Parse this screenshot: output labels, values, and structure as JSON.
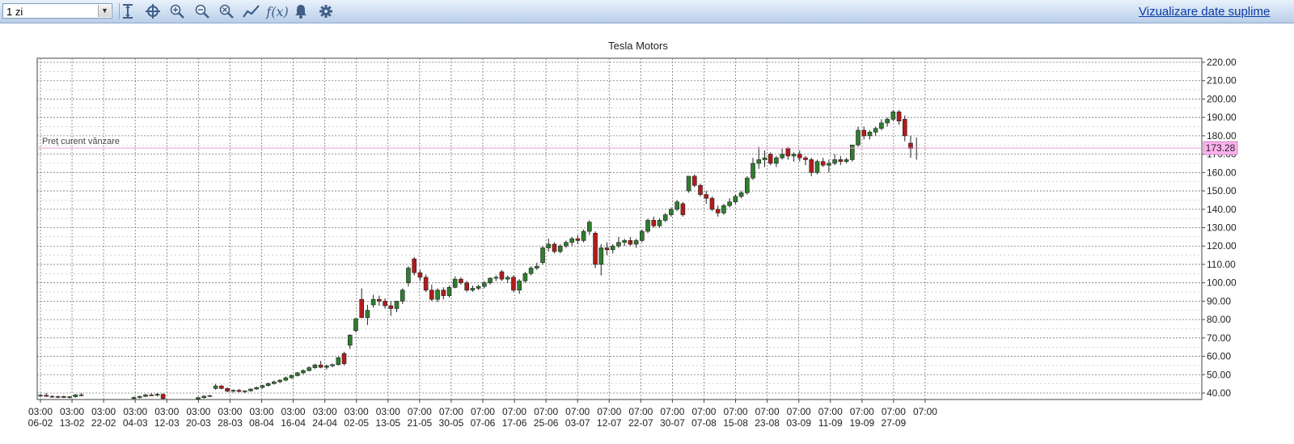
{
  "toolbar": {
    "period_value": "1 zi",
    "tools": [
      "cursor-icon",
      "crosshair-icon",
      "zoom-in-icon",
      "zoom-out-icon",
      "zoom-reset-icon",
      "line-chart-icon",
      "function-icon",
      "bell-icon",
      "gear-icon"
    ],
    "function_label": "f(x)",
    "link_text": "Vizualizare date suplime",
    "accent_color": "#4a6b94"
  },
  "chart_data": {
    "type": "candlestick",
    "title": "Tesla Motors",
    "ylim": [
      36,
      222
    ],
    "yticks": [
      "220.00",
      "210.00",
      "200.00",
      "190.00",
      "180.00",
      "170.00",
      "160.00",
      "150.00",
      "140.00",
      "130.00",
      "120.00",
      "110.00",
      "100.00",
      "90.00",
      "80.00",
      "70.00",
      "60.00",
      "50.00",
      "40.00"
    ],
    "current_price_label": "Preț curent vânzare",
    "current_price": 173.28,
    "current_price_text": "173.28",
    "xtick_times": [
      "03:00",
      "03:00",
      "03:00",
      "03:00",
      "03:00",
      "03:00",
      "03:00",
      "03:00",
      "03:00",
      "03:00",
      "03:00",
      "03:00",
      "07:00",
      "07:00",
      "07:00",
      "07:00",
      "07:00",
      "07:00",
      "07:00",
      "07:00",
      "07:00",
      "07:00",
      "07:00",
      "07:00",
      "07:00",
      "07:00",
      "07:00",
      "07:00",
      "07:00"
    ],
    "xtick_dates": [
      "06-02",
      "13-02",
      "22-02",
      "04-03",
      "12-03",
      "20-03",
      "28-03",
      "08-04",
      "16-04",
      "24-04",
      "02-05",
      "13-05",
      "21-05",
      "30-05",
      "07-06",
      "17-06",
      "25-06",
      "03-07",
      "12-07",
      "22-07",
      "30-07",
      "07-08",
      "15-08",
      "23-08",
      "03-09",
      "11-09",
      "19-09",
      "27-09",
      ""
    ],
    "grid": true,
    "colors": {
      "up": "#2f7d2f",
      "down": "#b31b1b",
      "price_line": "#e8a0d0",
      "price_label_bg": "#ffb3ef"
    },
    "candles": [
      [
        38.5,
        39.5,
        37.8,
        38.8
      ],
      [
        38.8,
        40.0,
        38.0,
        38.2
      ],
      [
        38.2,
        38.8,
        37.5,
        37.9
      ],
      [
        37.9,
        38.5,
        37.2,
        38.1
      ],
      [
        38.1,
        38.6,
        37.4,
        37.6
      ],
      [
        37.6,
        38.3,
        37.0,
        38.0
      ],
      [
        38.0,
        39.5,
        37.5,
        39.0
      ],
      [
        39.0,
        40.0,
        38.3,
        38.7
      ],
      null,
      null,
      null,
      null,
      null,
      null,
      null,
      null,
      [
        37.0,
        38.0,
        36.5,
        37.6
      ],
      [
        37.6,
        38.5,
        37.0,
        38.2
      ],
      [
        38.2,
        39.5,
        37.8,
        39.0
      ],
      [
        39.0,
        39.8,
        38.4,
        38.8
      ],
      [
        38.8,
        40.0,
        38.2,
        39.3
      ],
      [
        39.3,
        39.8,
        36.5,
        37.0
      ],
      null,
      null,
      null,
      null,
      null,
      [
        36.8,
        38.0,
        36.2,
        37.5
      ],
      [
        37.5,
        38.8,
        37.0,
        38.3
      ],
      [
        38.3,
        39.0,
        37.8,
        38.6
      ],
      [
        42.5,
        45.0,
        41.8,
        43.8
      ],
      [
        43.8,
        44.5,
        42.0,
        42.5
      ],
      [
        42.5,
        43.0,
        40.5,
        41.0
      ],
      [
        41.0,
        42.0,
        40.2,
        41.5
      ],
      [
        41.5,
        42.2,
        40.5,
        40.8
      ],
      [
        40.8,
        41.5,
        40.0,
        41.2
      ],
      [
        41.2,
        42.5,
        40.8,
        42.2
      ],
      [
        42.2,
        43.5,
        41.8,
        43.0
      ],
      [
        43.0,
        44.5,
        42.5,
        44.1
      ],
      [
        44.1,
        45.8,
        43.6,
        45.2
      ],
      [
        45.2,
        46.8,
        44.6,
        46.1
      ],
      [
        46.1,
        47.5,
        45.5,
        47.0
      ],
      [
        47.0,
        49.0,
        46.5,
        48.3
      ],
      [
        48.3,
        50.0,
        47.8,
        49.5
      ],
      [
        49.5,
        51.5,
        49.0,
        51.0
      ],
      [
        51.0,
        53.0,
        50.3,
        52.2
      ],
      [
        52.2,
        54.5,
        51.8,
        53.8
      ],
      [
        53.8,
        56.0,
        53.2,
        55.3
      ],
      [
        55.3,
        57.5,
        53.5,
        54.0
      ],
      [
        54.0,
        55.5,
        52.8,
        54.8
      ],
      [
        54.8,
        56.0,
        54.0,
        55.5
      ],
      [
        55.5,
        60.0,
        55.0,
        59.2
      ],
      [
        61.5,
        62.5,
        55.0,
        56.0
      ],
      [
        66.0,
        72.0,
        64.0,
        71.5
      ],
      [
        74.0,
        80.0,
        73.0,
        80.5
      ],
      [
        91.0,
        97.0,
        86.0,
        81.0
      ],
      [
        81.0,
        88.0,
        77.0,
        85.0
      ],
      [
        88.0,
        93.5,
        86.5,
        91.0
      ],
      [
        91.0,
        93.0,
        87.5,
        90.0
      ],
      [
        90.0,
        91.5,
        86.0,
        87.5
      ],
      [
        87.5,
        90.0,
        82.0,
        86.0
      ],
      [
        86.0,
        90.0,
        84.0,
        90.0
      ],
      [
        90.0,
        97.0,
        88.5,
        96.0
      ],
      [
        100.0,
        109.0,
        98.0,
        108.0
      ],
      [
        113.0,
        114.0,
        104.0,
        105.5
      ],
      [
        105.5,
        107.0,
        101.0,
        103.0
      ],
      [
        103.0,
        104.5,
        95.0,
        96.0
      ],
      [
        96.0,
        99.0,
        90.0,
        91.0
      ],
      [
        91.0,
        97.0,
        89.5,
        96.0
      ],
      [
        96.0,
        97.5,
        91.0,
        93.0
      ],
      [
        93.0,
        98.5,
        92.0,
        97.5
      ],
      [
        97.5,
        103.5,
        97.0,
        102.0
      ],
      [
        102.0,
        103.0,
        99.0,
        100.0
      ],
      [
        100.0,
        101.0,
        95.0,
        96.0
      ],
      [
        96.0,
        98.5,
        95.0,
        97.0
      ],
      [
        97.0,
        99.0,
        96.0,
        98.0
      ],
      [
        98.0,
        101.0,
        97.0,
        100.0
      ],
      [
        100.0,
        103.0,
        99.0,
        102.5
      ],
      [
        102.5,
        104.0,
        101.0,
        103.0
      ],
      [
        106.0,
        107.0,
        101.0,
        102.0
      ],
      [
        102.0,
        104.0,
        100.0,
        103.0
      ],
      [
        103.0,
        104.0,
        95.0,
        96.0
      ],
      [
        96.0,
        102.0,
        94.0,
        101.0
      ],
      [
        101.0,
        106.0,
        100.0,
        105.0
      ],
      [
        105.0,
        109.0,
        104.0,
        108.0
      ],
      [
        108.0,
        111.0,
        107.0,
        109.0
      ],
      [
        111.0,
        120.0,
        110.0,
        119.0
      ],
      [
        119.0,
        124.0,
        117.0,
        121.0
      ],
      [
        121.0,
        122.0,
        116.0,
        117.0
      ],
      [
        117.0,
        121.0,
        116.0,
        120.0
      ],
      [
        120.0,
        123.0,
        119.0,
        122.0
      ],
      [
        122.0,
        125.0,
        120.0,
        124.0
      ],
      [
        124.0,
        126.0,
        121.0,
        123.0
      ],
      [
        123.0,
        129.0,
        122.0,
        128.0
      ],
      [
        128.0,
        134.0,
        126.0,
        133.0
      ],
      [
        127.0,
        128.0,
        108.0,
        110.0
      ],
      [
        110.0,
        121.0,
        104.0,
        119.0
      ],
      [
        119.0,
        122.0,
        115.0,
        118.0
      ],
      [
        118.0,
        121.0,
        116.0,
        120.0
      ],
      [
        120.0,
        125.0,
        119.0,
        122.0
      ],
      [
        122.0,
        124.0,
        120.0,
        123.0
      ],
      [
        123.0,
        125.0,
        120.0,
        121.0
      ],
      [
        121.0,
        124.0,
        119.0,
        123.0
      ],
      [
        123.0,
        129.0,
        122.0,
        128.0
      ],
      [
        128.0,
        135.0,
        127.0,
        134.0
      ],
      [
        134.0,
        136.0,
        130.0,
        131.0
      ],
      [
        131.0,
        135.0,
        130.0,
        134.0
      ],
      [
        134.0,
        138.0,
        133.0,
        137.0
      ],
      [
        137.0,
        141.0,
        136.0,
        140.0
      ],
      [
        140.0,
        145.0,
        139.0,
        144.0
      ],
      [
        143.0,
        144.0,
        136.0,
        137.0
      ],
      [
        150.0,
        155.0,
        149.0,
        158.0
      ],
      [
        158.0,
        159.0,
        152.0,
        153.0
      ],
      [
        153.0,
        154.0,
        147.0,
        148.0
      ],
      [
        148.0,
        150.0,
        143.0,
        146.0
      ],
      [
        146.0,
        147.0,
        139.0,
        140.0
      ],
      [
        140.0,
        142.0,
        136.0,
        138.0
      ],
      [
        138.0,
        143.0,
        137.0,
        142.0
      ],
      [
        142.0,
        146.0,
        141.0,
        144.0
      ],
      [
        144.0,
        148.0,
        143.0,
        147.0
      ],
      [
        147.0,
        150.0,
        146.0,
        149.0
      ],
      [
        149.0,
        158.0,
        148.0,
        157.0
      ],
      [
        157.0,
        168.0,
        156.0,
        165.0
      ],
      [
        165.0,
        174.0,
        162.0,
        167.0
      ],
      [
        167.0,
        172.0,
        163.0,
        168.0
      ],
      [
        170.0,
        171.0,
        164.0,
        165.0
      ],
      [
        165.0,
        169.0,
        163.0,
        168.0
      ],
      [
        168.0,
        173.0,
        167.0,
        170.0
      ],
      [
        173.0,
        174.0,
        167.0,
        169.0
      ],
      [
        169.0,
        171.0,
        166.0,
        170.0
      ],
      [
        170.0,
        172.0,
        166.0,
        168.0
      ],
      [
        168.0,
        169.0,
        164.0,
        167.0
      ],
      [
        167.0,
        168.0,
        158.0,
        160.0
      ],
      [
        160.0,
        167.0,
        159.0,
        166.0
      ],
      [
        166.0,
        168.0,
        163.0,
        164.0
      ],
      [
        164.0,
        167.0,
        160.0,
        165.0
      ],
      [
        165.0,
        170.0,
        164.0,
        167.0
      ],
      [
        167.0,
        169.0,
        164.0,
        166.0
      ],
      [
        166.0,
        168.0,
        165.0,
        167.0
      ],
      [
        167.0,
        173.0,
        166.0,
        175.0
      ],
      [
        175.0,
        185.0,
        174.0,
        183.0
      ],
      [
        183.0,
        185.0,
        178.0,
        180.0
      ],
      [
        180.0,
        183.0,
        178.0,
        182.0
      ],
      [
        182.0,
        185.0,
        180.0,
        184.0
      ],
      [
        184.0,
        189.0,
        183.0,
        187.0
      ],
      [
        187.0,
        190.0,
        185.0,
        189.0
      ],
      [
        189.0,
        194.0,
        188.0,
        193.0
      ],
      [
        193.0,
        194.0,
        186.0,
        188.0
      ],
      [
        189.0,
        191.0,
        177.0,
        180.0
      ],
      [
        176.0,
        180.0,
        168.0,
        173.0
      ]
    ]
  }
}
